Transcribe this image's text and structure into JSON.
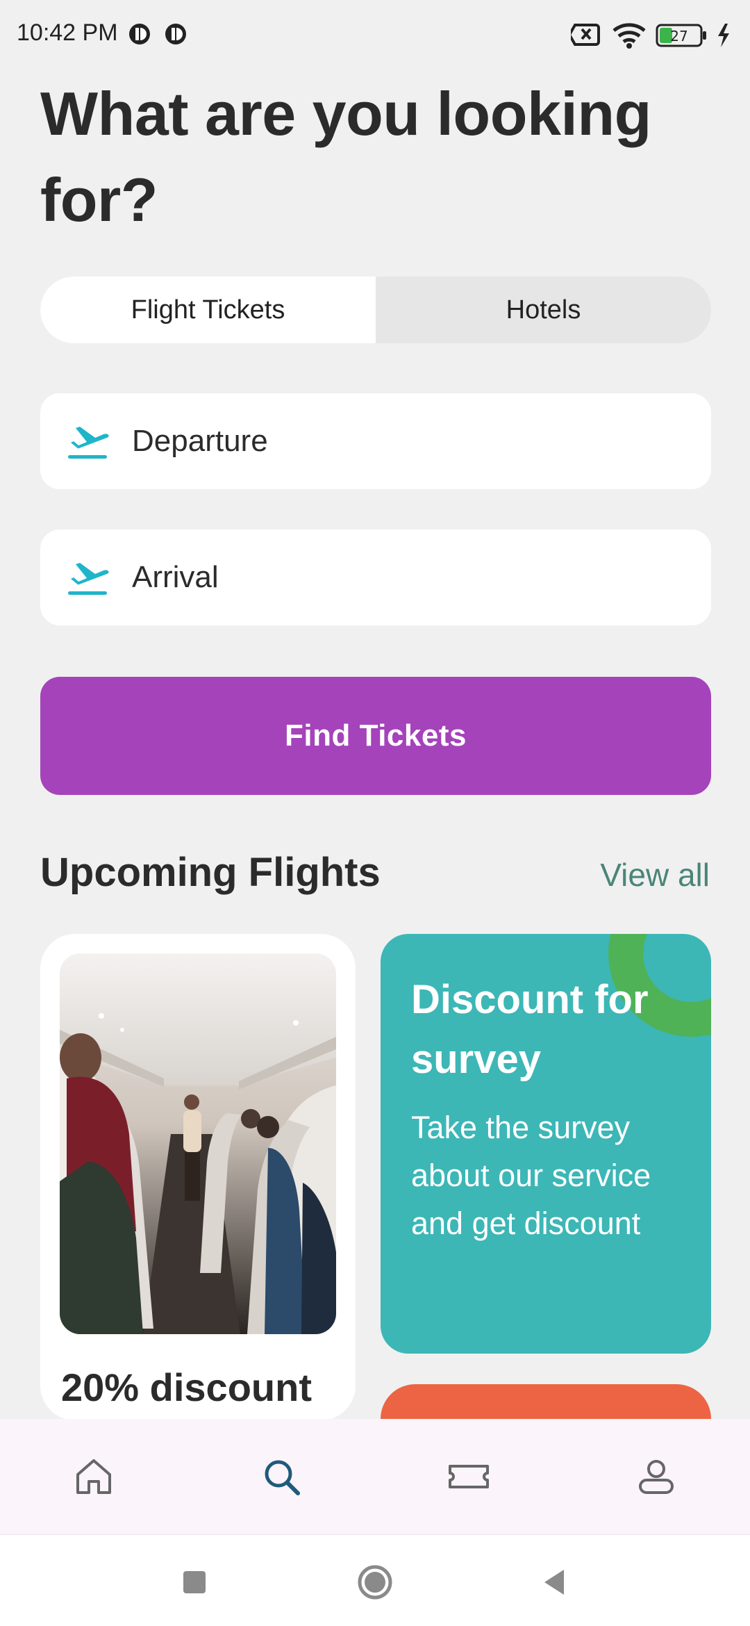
{
  "status_bar": {
    "time": "10:42 PM",
    "battery_level": "27",
    "icons": [
      "notification-icon",
      "notification-icon",
      "sim-off-icon",
      "wifi-icon",
      "battery-icon",
      "charging-icon"
    ]
  },
  "page": {
    "title": "What are you looking for?"
  },
  "tabs": [
    {
      "label": "Flight Tickets",
      "active": true
    },
    {
      "label": "Hotels",
      "active": false
    }
  ],
  "search": {
    "departure_label": "Departure",
    "arrival_label": "Arrival",
    "find_button_label": "Find Tickets"
  },
  "upcoming": {
    "section_title": "Upcoming Flights",
    "view_all_label": "View all",
    "flight_card": {
      "title": "20% discount",
      "image_subject": "airplane cabin interior"
    },
    "survey_card": {
      "title": "Discount for survey",
      "description": "Take the survey about our service and get discount"
    }
  },
  "bottom_nav": {
    "items": [
      "home-icon",
      "search-icon",
      "ticket-icon",
      "profile-icon"
    ],
    "active": "search-icon"
  },
  "colors": {
    "background": "#f0f0f0",
    "primary_button": "#a543bb",
    "survey_card": "#3db6b6",
    "survey_ring": "#4fb257",
    "orange_card": "#ec6444",
    "accent_text": "#4a8577",
    "plane_icon": "#1fb5c9",
    "nav_active": "#1f5a7a"
  }
}
